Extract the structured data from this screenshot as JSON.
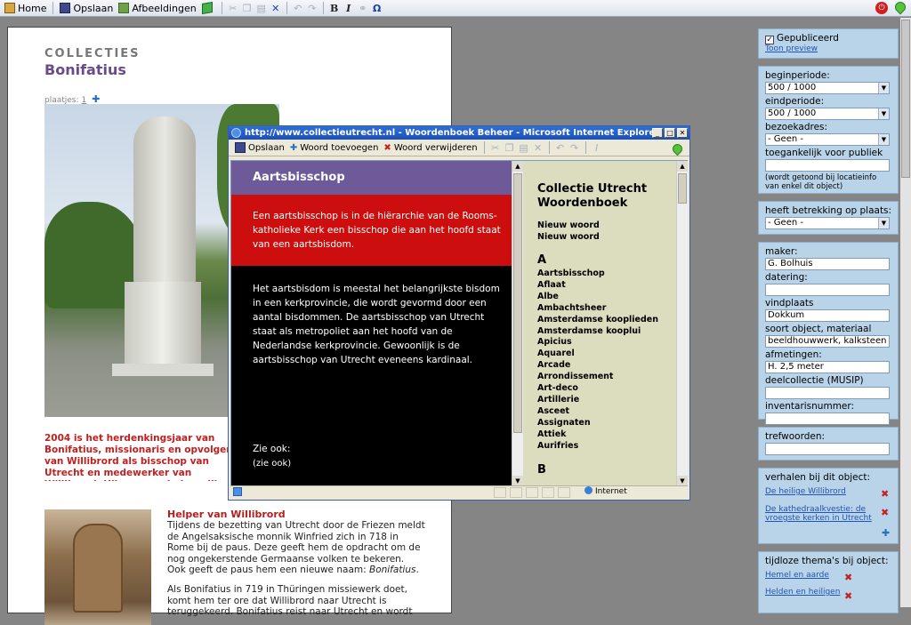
{
  "toolbar": {
    "home": "Home",
    "save": "Opslaan",
    "images": "Afbeeldingen",
    "bold": "B",
    "italic": "I",
    "omega": "Ω"
  },
  "page": {
    "kicker": "COLLECTIES",
    "title": "Bonifatius",
    "plaatjes_label": "plaatjes:",
    "plaatjes_link": "1",
    "intro": "2004 is het herdenkingsjaar van Bonifatius, missionaris en opvolger van Willibrord als bisschop van Utrecht en medewerker van Willibrord. Hij was een belangrijke figuur in de vestiging van de Rooms-katholieke Kerk. In de aandacht rond zijn herdenking speelt hij de hoofdrol.",
    "section_title": "Helper van Willibrord",
    "section_body": "Tijdens de bezetting van Utrecht door de Friezen meldt de Angelsaksische monnik Winfried zich in 718 in Rome bij de paus. Deze geeft hem de opdracht om de nog ongekerstende Germaanse volken te bekeren. Ook geeft de paus hem een nieuwe naam: ",
    "section_body_em": "Bonifatius",
    "section_body_end": ".",
    "section_body2": "Als Bonifatius in 719 in Thüringen missiewerk doet, komt hem ter ore dat Willibrord naar Utrecht is teruggekeerd. Bonifatius reist naar Utrecht en wordt"
  },
  "sidebar": {
    "published_label": "Gepubliceerd",
    "preview_link": "Toon preview",
    "begin_label": "beginperiode:",
    "begin_value": "500 / 1000",
    "end_label": "eindperiode:",
    "end_value": "500 / 1000",
    "visit_label": "bezoekadres:",
    "visit_value": "- Geen -",
    "access_label": "toegankelijk voor publiek",
    "access_hint": "(wordt getoond bij locatieinfo van enkel dit object)",
    "place_label": "heeft betrekking op plaats:",
    "place_value": "- Geen -",
    "maker_label": "maker:",
    "maker_value": "G. Bolhuis",
    "date_label": "datering:",
    "date_value": "",
    "found_label": "vindplaats",
    "found_value": "Dokkum",
    "type_label": "soort object, materiaal",
    "type_value": "beeldhouwwerk, kalksteen",
    "size_label": "afmetingen:",
    "size_value": "H. 2,5 meter",
    "part_label": "deelcollectie (MUSIP)",
    "part_value": "",
    "inv_label": "inventarisnummer:",
    "inv_value": "",
    "tags_label": "trefwoorden:",
    "tags_value": "",
    "stories_label": "verhalen bij dit object:",
    "stories": [
      "De heilige Willibrord",
      "De kathedraalkvestie: de vroegste kerken in Utrecht"
    ],
    "themes_label": "tijdloze thema's bij object:",
    "themes": [
      "Hemel en aarde",
      "Helden en heiligen"
    ]
  },
  "popup": {
    "title": "http://www.collectieutrecht.nl - Woordenboek Beheer - Microsoft Internet Explorer",
    "save": "Opslaan",
    "add_word": "Woord toevoegen",
    "remove_word": "Woord verwijderen",
    "word": "Aartsbisschop",
    "definition": "Een aartsbisschop is in de hiërarchie van de Rooms-katholieke Kerk een bisschop die aan het hoofd staat van een aartsbisdom.",
    "text": "Het aartsbisdom is meestal het belangrijkste bisdom in een kerkprovincie, die wordt gevormd door een aantal bisdommen. De aartsbisschop van Utrecht staat als metropoliet aan het hoofd van de Nederlandse kerkprovincie. Gewoonlijk is de aartsbisschop van Utrecht eveneens kardinaal.",
    "see_also_label": "Zie ook:",
    "see_also_value": "(zie ook)",
    "dict_title": "Collectie Utrecht Woordenboek",
    "new_words": [
      "Nieuw woord",
      "Nieuw woord"
    ],
    "letter_a": "A",
    "words_a": [
      "Aartsbisschop",
      "Aflaat",
      "Albe",
      "Ambachtsheer",
      "Amsterdamse kooplieden",
      "Amsterdamse kooplui",
      "Apicius",
      "Aquarel",
      "Arcade",
      "Arrondissement",
      "Art-deco",
      "Artillerie",
      "Asceet",
      "Assignaten",
      "Attiek",
      "Aurifries"
    ],
    "letter_b": "B",
    "status_zone": "Internet"
  }
}
